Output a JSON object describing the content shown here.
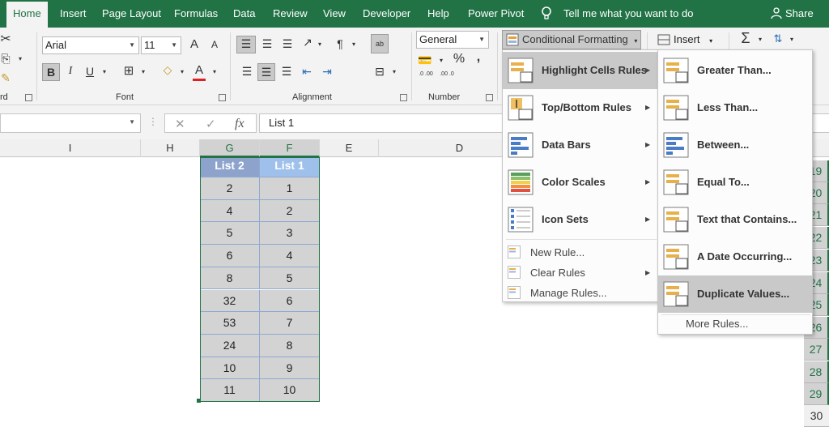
{
  "tabs": [
    "Home",
    "Insert",
    "Page Layout",
    "Formulas",
    "Data",
    "Review",
    "View",
    "Developer",
    "Help",
    "Power Pivot"
  ],
  "tell_me": "Tell me what you want to do",
  "share": "Share",
  "ribbon": {
    "font_name": "Arial",
    "font_size": "11",
    "number_format": "General",
    "group_clipboard": "rd",
    "group_font": "Font",
    "group_alignment": "Alignment",
    "group_number": "Number",
    "conditional_formatting": "Conditional Formatting",
    "insert": "Insert",
    "percent": "%",
    "comma": ",",
    "inc_decimal": ".0 .00",
    "dec_decimal": ".00 .0",
    "bold": "B",
    "italic": "I",
    "underline": "U",
    "grow_font": "A",
    "shrink_font": "A",
    "font_color": "A",
    "sigma": "Σ"
  },
  "formula_bar": {
    "name_box": "",
    "cancel": "✕",
    "enter": "✓",
    "fx": "fx",
    "content": "List 1"
  },
  "columns": [
    {
      "label": "I"
    },
    {
      "label": "H"
    },
    {
      "label": "G"
    },
    {
      "label": "F"
    },
    {
      "label": "E"
    },
    {
      "label": "D"
    }
  ],
  "table": {
    "headers": [
      "List 2",
      "List 1"
    ],
    "header_colors": [
      "#8ea3cc",
      "#9ec0ea"
    ],
    "rows": [
      [
        "2",
        "1"
      ],
      [
        "4",
        "2"
      ],
      [
        "5",
        "3"
      ],
      [
        "6",
        "4"
      ],
      [
        "8",
        "5"
      ],
      [
        "32",
        "6"
      ],
      [
        "53",
        "7"
      ],
      [
        "24",
        "8"
      ],
      [
        "10",
        "9"
      ],
      [
        "11",
        "10"
      ]
    ]
  },
  "row_numbers": [
    "19",
    "20",
    "21",
    "22",
    "23",
    "24",
    "25",
    "26",
    "27",
    "28",
    "29",
    "30"
  ],
  "cf_menu": {
    "items": [
      {
        "label": "Highlight Cells Rules",
        "icon": "highlight-cells-icon"
      },
      {
        "label": "Top/Bottom Rules",
        "icon": "top-bottom-icon"
      },
      {
        "label": "Data Bars",
        "icon": "data-bars-icon"
      },
      {
        "label": "Color Scales",
        "icon": "color-scales-icon"
      },
      {
        "label": "Icon Sets",
        "icon": "icon-sets-icon"
      }
    ],
    "small_items": [
      {
        "label": "New Rule..."
      },
      {
        "label": "Clear Rules"
      },
      {
        "label": "Manage Rules..."
      }
    ]
  },
  "hcr_menu": {
    "items": [
      {
        "label": "Greater Than..."
      },
      {
        "label": "Less Than..."
      },
      {
        "label": "Between..."
      },
      {
        "label": "Equal To..."
      },
      {
        "label": "Text that Contains..."
      },
      {
        "label": "A Date Occurring..."
      },
      {
        "label": "Duplicate Values..."
      }
    ],
    "more": "More Rules..."
  },
  "colors": {
    "accent": "#217346",
    "menu_highlight": "#c9c9c9",
    "cell_fill": "#d3d3d3",
    "cell_border": "#8ea9d2"
  }
}
